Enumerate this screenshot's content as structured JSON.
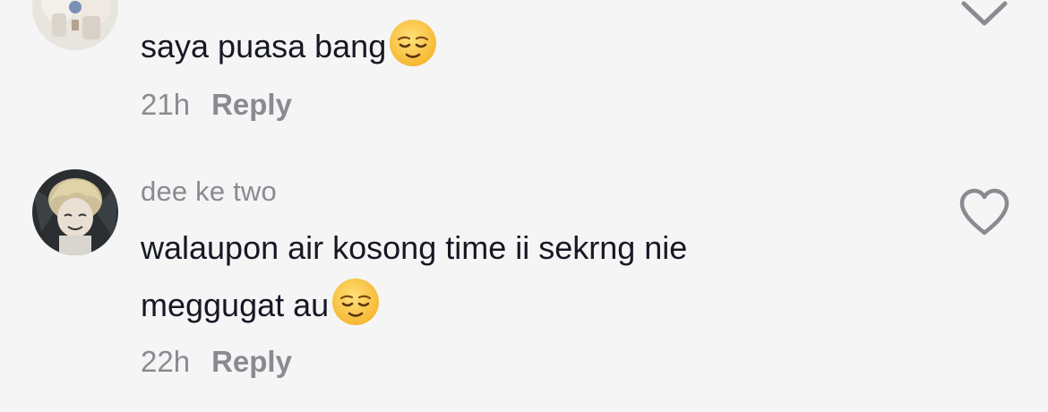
{
  "comments": [
    {
      "username": "",
      "text": "saya puasa bang",
      "emoji": "relieved-face-emoji",
      "time": "21h",
      "reply_label": "Reply",
      "action_icon": "chevron-down-icon"
    },
    {
      "username": "dee ke two",
      "text_line1": "walaupon air kosong time ii sekrng nie",
      "text_line2": "meggugat au",
      "emoji": "relieved-face-emoji",
      "time": "22h",
      "reply_label": "Reply",
      "action_icon": "heart-outline-icon"
    }
  ],
  "colors": {
    "background": "#f5f5f6",
    "text": "#161823",
    "secondary": "#8a8b91"
  }
}
